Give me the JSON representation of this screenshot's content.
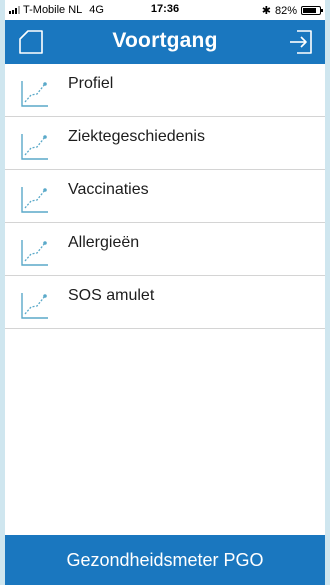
{
  "status_bar": {
    "carrier": "T-Mobile NL",
    "network": "4G",
    "time": "17:36",
    "battery": "82%",
    "battery_level": 0.82
  },
  "header": {
    "title": "Voortgang",
    "left_icon": "home-icon",
    "right_icon": "exit-icon"
  },
  "menu": {
    "items": [
      {
        "label": "Profiel",
        "icon": "line-chart-icon"
      },
      {
        "label": "Ziektegeschiedenis",
        "icon": "line-chart-icon"
      },
      {
        "label": "Vaccinaties",
        "icon": "line-chart-icon"
      },
      {
        "label": "Allergieën",
        "icon": "line-chart-icon"
      },
      {
        "label": "SOS amulet",
        "icon": "line-chart-icon"
      }
    ]
  },
  "footer": {
    "label": "Gezondheidsmeter PGO"
  },
  "colors": {
    "brand": "#1a77bf",
    "icon": "#5aa9c9",
    "background": "#cfe6ef"
  }
}
